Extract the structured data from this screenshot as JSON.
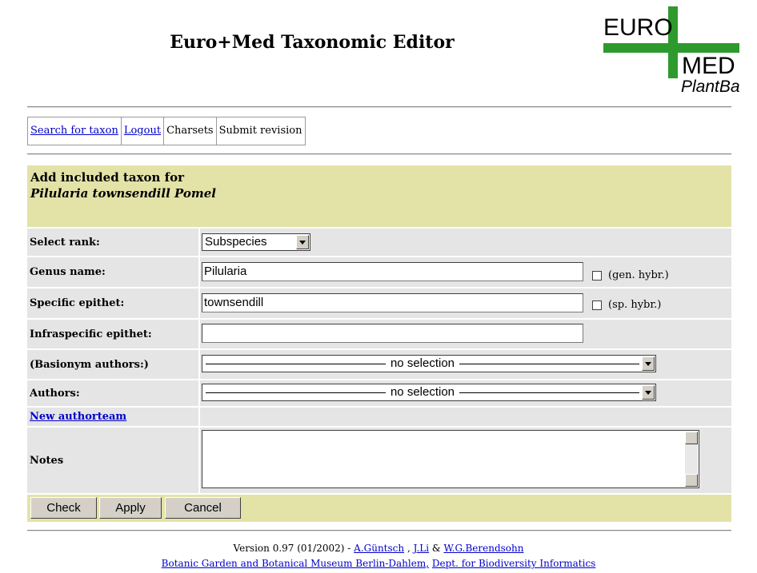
{
  "header": {
    "title": "Euro+Med Taxonomic Editor"
  },
  "logo": {
    "euro": "EURO",
    "med": "MED",
    "plantbase": "PlantBase",
    "green": "#2e9a2e"
  },
  "nav": {
    "search": "Search for taxon",
    "logout": "Logout",
    "charsets": "Charsets",
    "submit": "Submit revision"
  },
  "panel": {
    "heading": "Add included taxon for",
    "taxon": "Pilularia townsendill Pomel"
  },
  "form": {
    "rank_label": "Select rank:",
    "rank_value": "Subspecies",
    "genus_label": "Genus name:",
    "genus_value": "Pilularia",
    "gen_hybr": "(gen. hybr.)",
    "specific_label": "Specific epithet:",
    "specific_value": "townsendill",
    "sp_hybr": "(sp. hybr.)",
    "infra_label": "Infraspecific epithet:",
    "infra_value": "",
    "basionym_label": "(Basionym authors:)",
    "basionym_value": "no selection",
    "authors_label": "Authors:",
    "authors_value": "no selection",
    "new_authorteam": "New authorteam",
    "notes_label": "Notes",
    "notes_value": ""
  },
  "buttons": {
    "check": "Check",
    "apply": "Apply",
    "cancel": "Cancel"
  },
  "footer": {
    "version": "Version 0.97 (01/2002) -",
    "author1": "A.Güntsch",
    "sep1": ",",
    "author2": "J.Li",
    "amp": "&",
    "author3": "W.G.Berendsohn",
    "inst1": "Botanic Garden and Botanical Museum Berlin-Dahlem,",
    "inst2": "Dept. for Biodiversity Informatics"
  },
  "colors": {
    "panel": "#e3e3a8",
    "row": "#e5e5e5",
    "link": "#0000cc"
  }
}
